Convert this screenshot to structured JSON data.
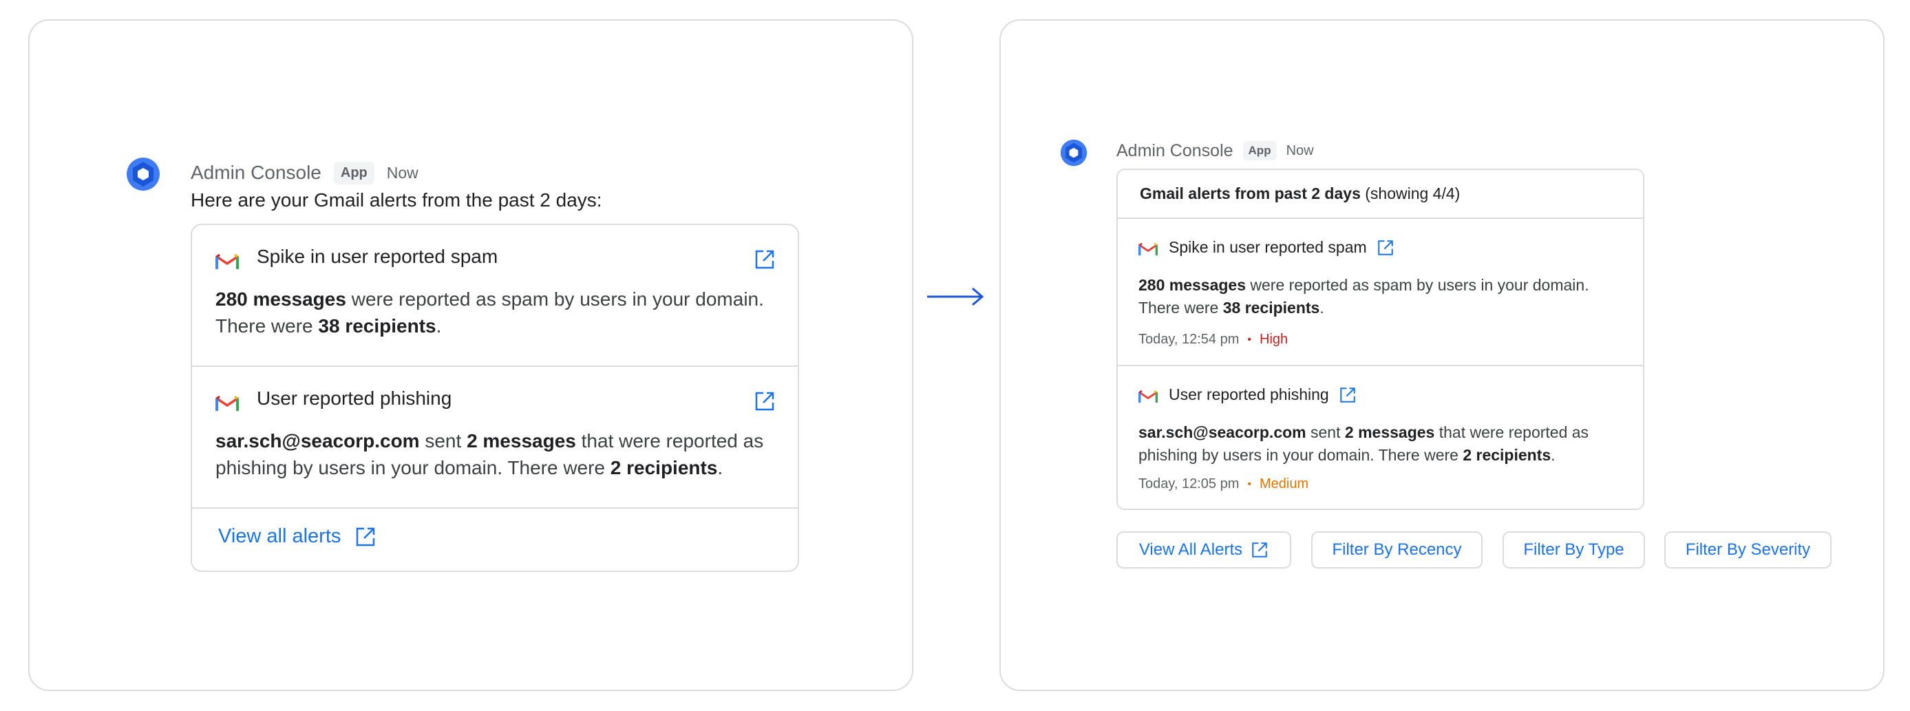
{
  "left": {
    "sender": "Admin Console",
    "app_chip": "App",
    "time": "Now",
    "intro": "Here are your Gmail alerts from the past 2 days:",
    "alerts": [
      {
        "title": "Spike in user reported spam",
        "body_parts": [
          "280 messages",
          " were reported as spam by users in your domain. There were ",
          "38 recipients",
          "."
        ]
      },
      {
        "title": "User reported phishing",
        "body_parts": [
          "sar.sch@seacorp.com",
          " sent ",
          "2 messages",
          " that were reported as phishing by users in your domain. There were ",
          "2 recipients",
          "."
        ]
      }
    ],
    "view_all": "View all alerts"
  },
  "right": {
    "sender": "Admin Console",
    "app_chip": "App",
    "time": "Now",
    "header_bold": "Gmail alerts from past 2 days",
    "header_rest": " (showing 4/4)",
    "alerts": [
      {
        "title": "Spike in user reported spam",
        "body_parts": [
          "280 messages",
          " were reported as spam by users in your domain. There were ",
          "38 recipients",
          "."
        ],
        "timestamp": "Today, 12:54 pm",
        "separator": "•",
        "severity": "High"
      },
      {
        "title": "User reported phishing",
        "body_parts": [
          "sar.sch@seacorp.com",
          " sent ",
          "2 messages",
          " that were reported as phishing by users in your domain. There were ",
          "2 recipients",
          "."
        ],
        "timestamp": "Today, 12:05 pm",
        "separator": "•",
        "severity": "Medium"
      }
    ],
    "chips": {
      "view_all": "View All Alerts",
      "recency": "Filter By Recency",
      "type": "Filter By Type",
      "severity": "Filter By Severity"
    }
  },
  "colors": {
    "link_blue": "#1a73e8",
    "severity_high": "#c5221f",
    "severity_medium": "#e37400",
    "border": "#dadce0"
  },
  "icons": {
    "avatar": "admin-console-hexagon-icon",
    "alert": "gmail-icon",
    "link": "open-in-new-icon",
    "flow": "arrow-right-icon"
  }
}
